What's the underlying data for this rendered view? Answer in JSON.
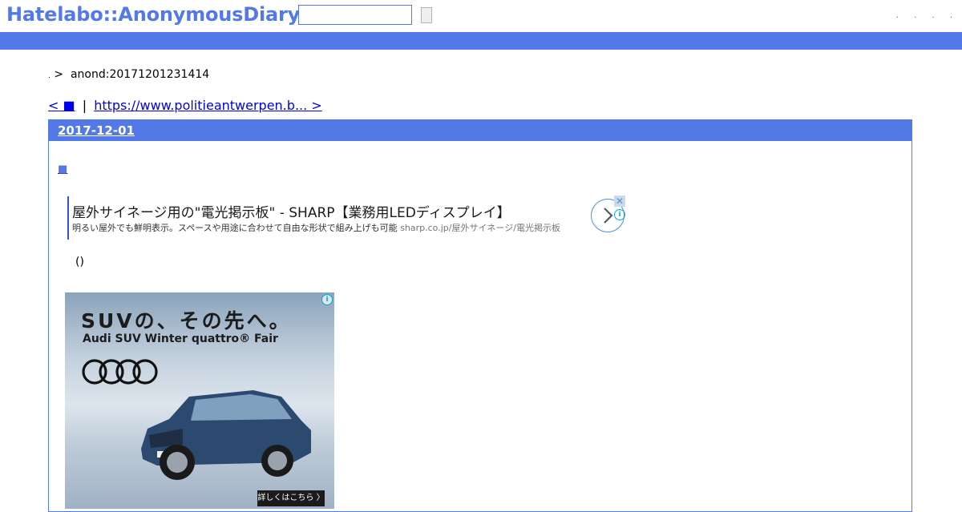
{
  "header": {
    "logo": "Hatelabo::AnonymousDiary",
    "search_value": "",
    "search_button_label": "",
    "links": [
      ".",
      ".",
      ".",
      "."
    ],
    "brand_color": "#5279e7"
  },
  "breadcrumb": {
    "dot": ".",
    "arrow": ">",
    "current": "anond:20171201231414"
  },
  "pager": {
    "prev": "< ■",
    "sep": "|",
    "next": "https://www.politieantwerpen.b... >"
  },
  "entry": {
    "date": "2017-12-01",
    "square": "■",
    "paren": "()"
  },
  "text_ad": {
    "headline": "屋外サイネージ用の\"電光掲示板\" - SHARP【業務用LEDディスプレイ】",
    "description": "明るい屋外でも鮮明表示。スペースや用途に合わせて自由な形状で組み上げも可能",
    "domain": "sharp.co.jp/屋外サイネージ/電光掲示板",
    "close_icon": "✕",
    "info_icon": "i"
  },
  "banner_ad": {
    "headline": "SUVの、その先へ。",
    "subheadline": "Audi SUV Winter quattro® Fair",
    "cta": "詳しくはこちら 〉",
    "info_icon": "i"
  }
}
